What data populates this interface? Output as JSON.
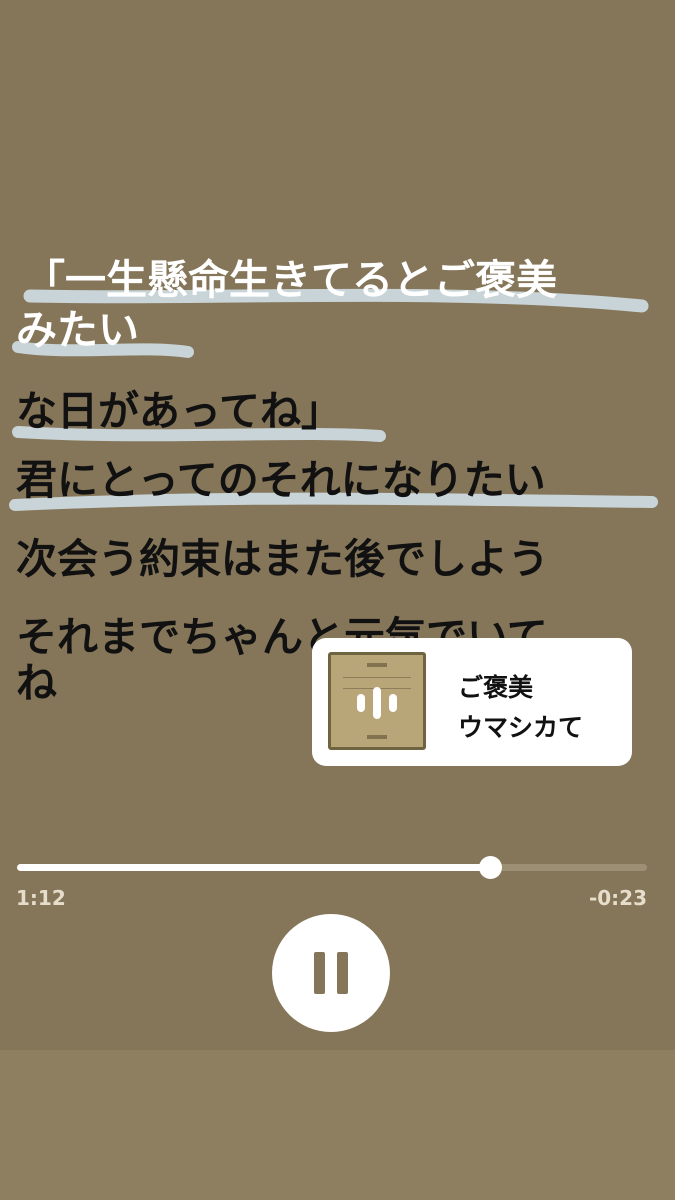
{
  "lyrics": [
    {
      "text": "「一生懸命生きてるとご褒美",
      "active": true
    },
    {
      "text": "みたい",
      "active": true
    },
    {
      "text": "な日があってね」",
      "active": false
    },
    {
      "text": "君にとってのそれになりたい",
      "active": false
    },
    {
      "text": "次会う約束はまた後でしよう",
      "active": false
    },
    {
      "text": "それまでちゃんと元気でいて",
      "active": false
    },
    {
      "text": "ね",
      "active": false
    }
  ],
  "track": {
    "title": "ご褒美",
    "artist": "ウマシカて",
    "artwork_icon": "audio-waveform-icon"
  },
  "playback": {
    "elapsed": "1:12",
    "remaining": "-0:23",
    "progress_fraction": 0.75,
    "state": "playing",
    "control_icon": "pause-icon"
  },
  "colors": {
    "background": "#85765A",
    "highlight": "#C9D4D8",
    "accent": "#FFFFFF"
  }
}
